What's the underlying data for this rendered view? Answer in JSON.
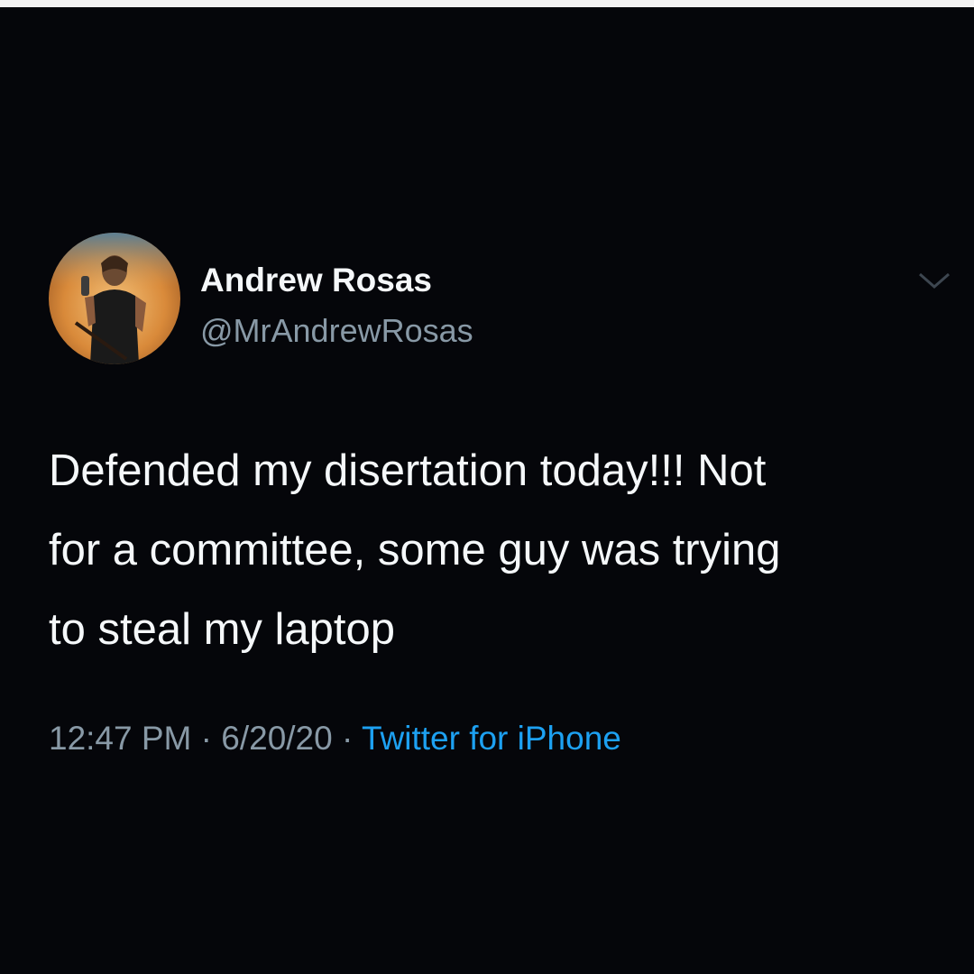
{
  "tweet": {
    "author": {
      "display_name": "Andrew Rosas",
      "handle": "@MrAndrewRosas",
      "avatar_icon": "profile-photo"
    },
    "caret_icon": "chevron-down-icon",
    "text": "Defended my disertation today!!!  Not\nfor a committee, some guy was trying\nto steal my laptop",
    "time": "12:47 PM",
    "separator": "·",
    "date": "6/20/20",
    "source": "Twitter for iPhone",
    "colors": {
      "background": "#05060a",
      "text": "#f5f8fa",
      "secondary": "#8899a6",
      "link": "#1da1f2"
    }
  }
}
